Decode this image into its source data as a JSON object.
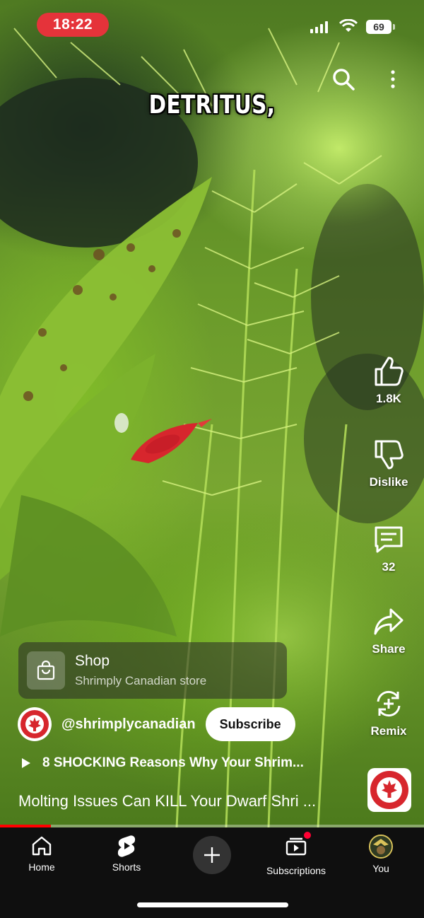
{
  "status_bar": {
    "time": "18:22",
    "battery": "69"
  },
  "video": {
    "caption": "DETRITUS,"
  },
  "top_actions": {
    "search_icon": "search-icon",
    "more_icon": "more-vertical-icon"
  },
  "actions": {
    "like_count": "1.8K",
    "dislike_label": "Dislike",
    "comment_count": "32",
    "share_label": "Share",
    "remix_label": "Remix"
  },
  "shop": {
    "title": "Shop",
    "subtitle": "Shrimply Canadian store",
    "icon": "shopping-bag-icon"
  },
  "channel": {
    "handle": "@shrimplycanadian",
    "subscribe_label": "Subscribe"
  },
  "playlist": {
    "title": "8 SHOCKING Reasons Why Your Shrim..."
  },
  "short": {
    "title": "Molting Issues Can KILL Your Dwarf Shri ..."
  },
  "progress": {
    "fraction": 0.12
  },
  "nav": {
    "home": "Home",
    "shorts": "Shorts",
    "subscriptions": "Subscriptions",
    "you": "You"
  },
  "colors": {
    "accent": "#ff0000",
    "time_pill": "#e5333a",
    "nav_bg": "#0f0f0f"
  }
}
